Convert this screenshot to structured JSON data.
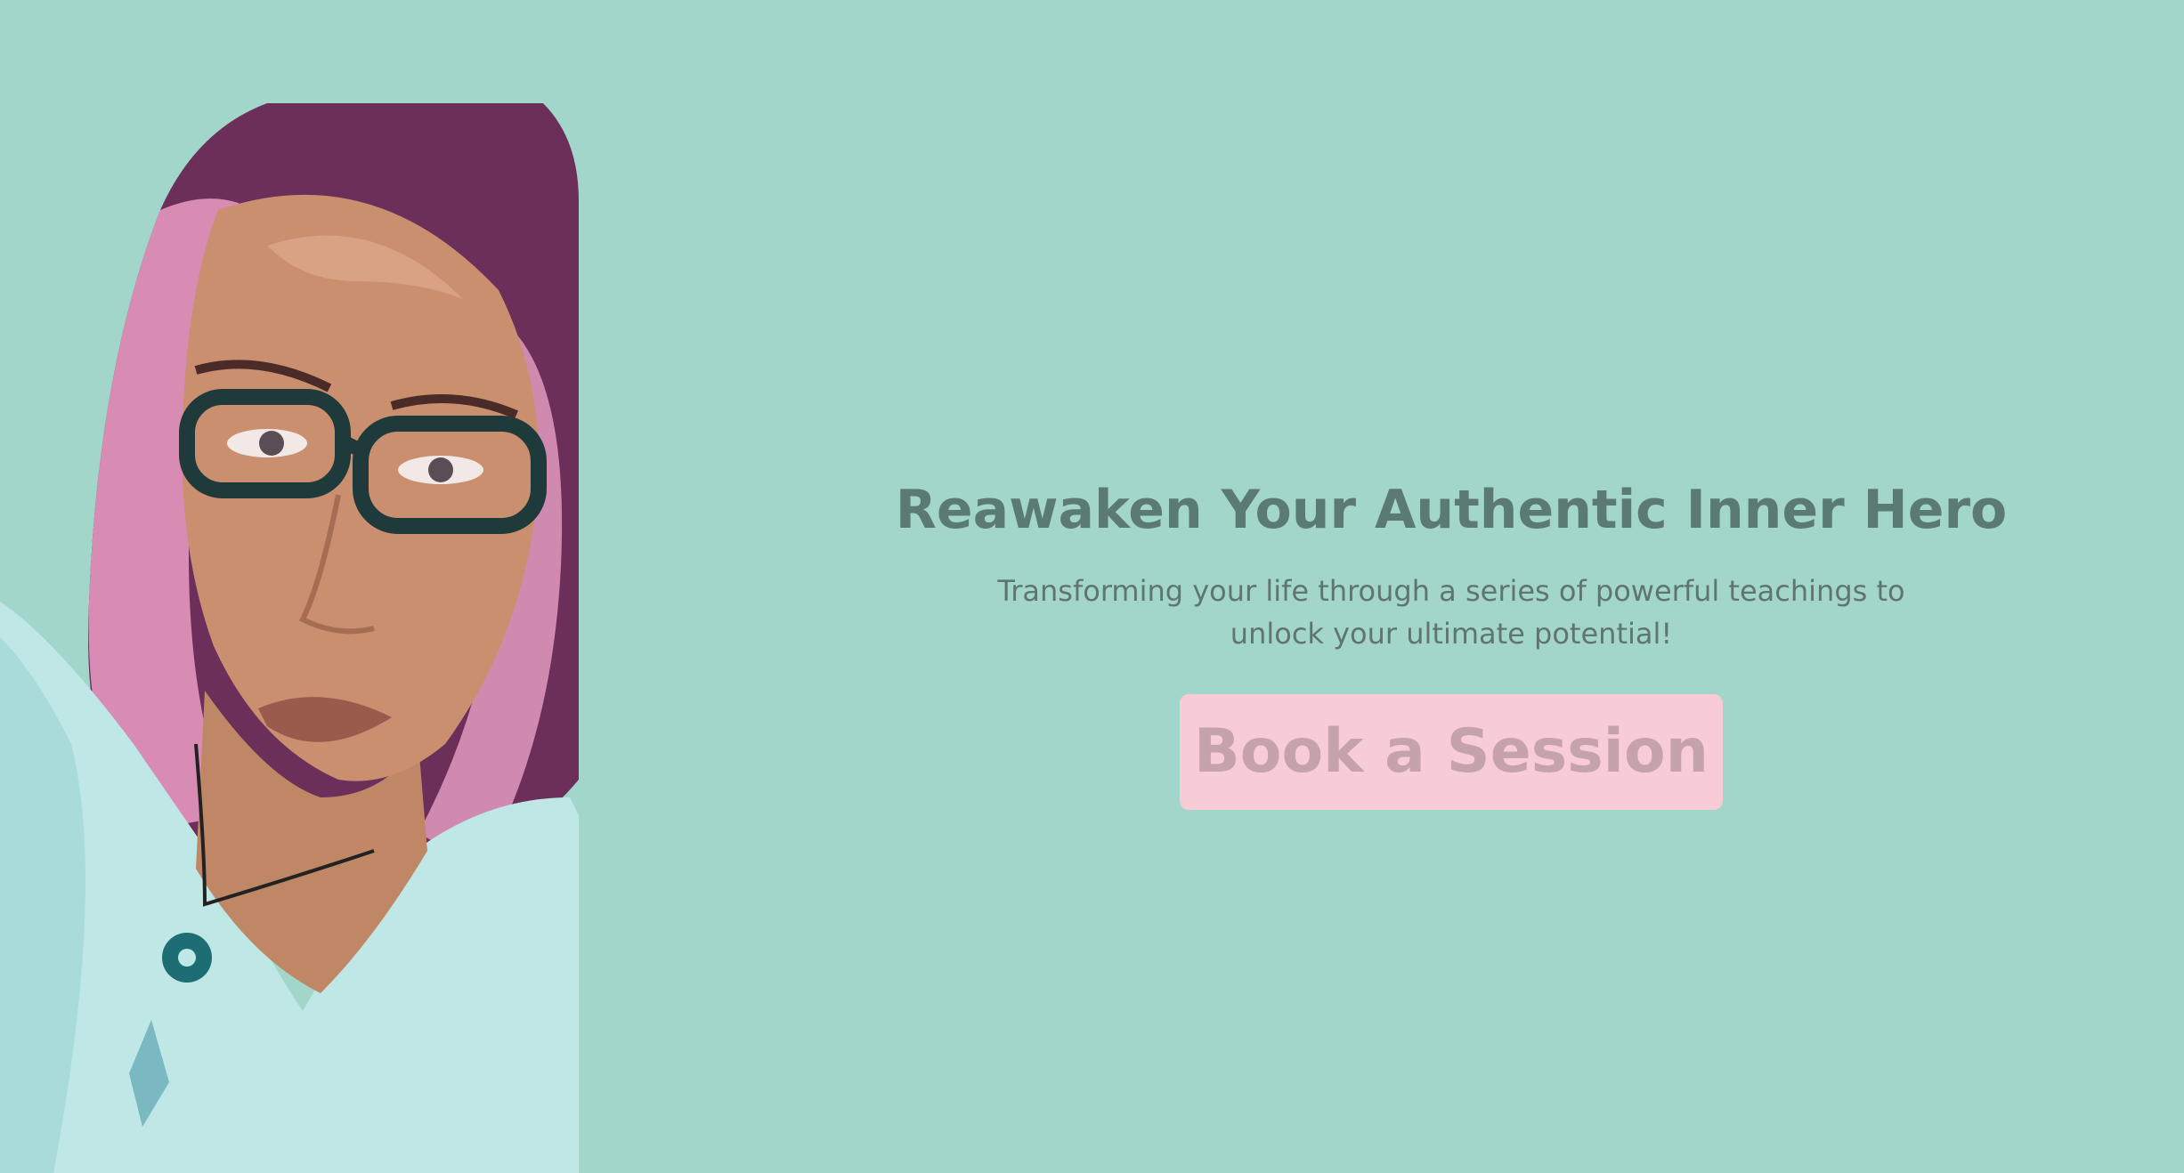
{
  "colors": {
    "background": "#a3d6cb",
    "heading_text": "#5b7a73",
    "body_text": "#5f7570",
    "button_bg": "#f7ccd6",
    "button_text": "#c6a2aa",
    "shirt": "#bfe7e5",
    "hair": "#d88cb3",
    "skin": "#c98f6e"
  },
  "hero": {
    "title": "Reawaken Your Authentic Inner Hero",
    "subtitle": "Transforming your life through a series of powerful teachings to unlock your ultimate potential!",
    "cta_label": "Book a Session"
  },
  "portrait": {
    "icon": "person-portrait"
  }
}
